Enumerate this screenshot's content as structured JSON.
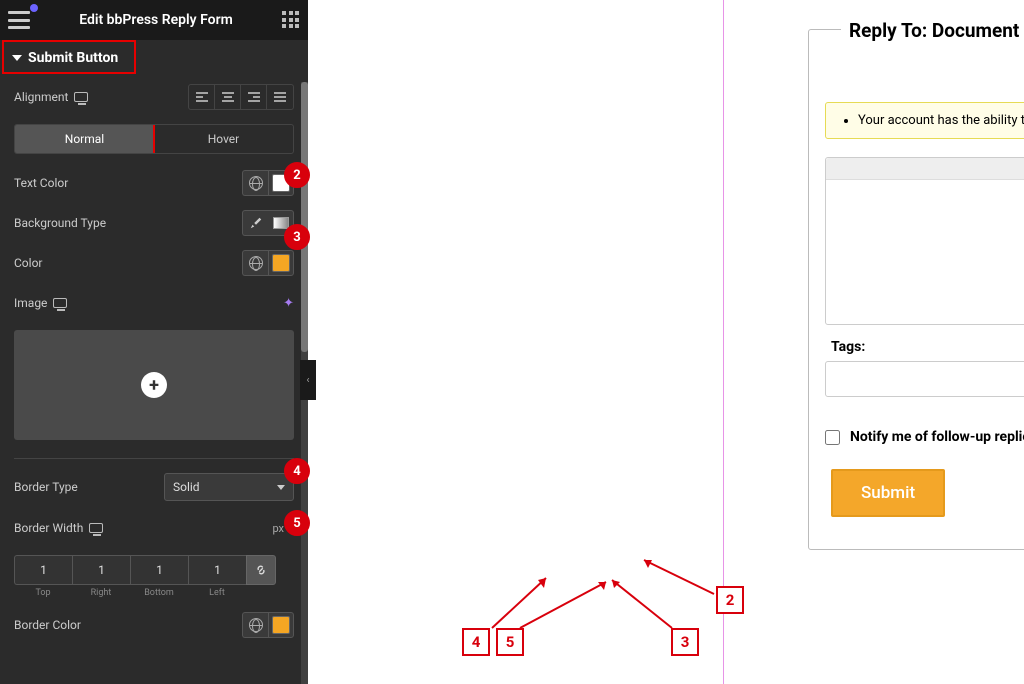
{
  "header": {
    "title": "Edit bbPress Reply Form"
  },
  "accordion": {
    "title": "Submit Button"
  },
  "controls": {
    "alignment_label": "Alignment",
    "tabs": {
      "normal": "Normal",
      "hover": "Hover"
    },
    "text_color_label": "Text Color",
    "bg_type_label": "Background Type",
    "color_label": "Color",
    "image_label": "Image",
    "border_type_label": "Border Type",
    "border_type_value": "Solid",
    "border_width_label": "Border Width",
    "border_width_unit": "px",
    "width_values": {
      "top": "1",
      "right": "1",
      "bottom": "1",
      "left": "1"
    },
    "width_labels": {
      "top": "Top",
      "right": "Right",
      "bottom": "Bottom",
      "left": "Left"
    },
    "border_color_label": "Border Color"
  },
  "preview": {
    "legend": "Reply To: Document Writing",
    "notice": "Your account has the ability to post unrestricted HTML content.",
    "tags_label": "Tags:",
    "notify_label": "Notify me of follow-up replies via email",
    "submit_label": "Submit"
  },
  "annotations": {
    "b2": "2",
    "b3": "3",
    "b4": "4",
    "b5": "5",
    "c2": "2",
    "c3": "3",
    "c4": "4",
    "c5": "5"
  },
  "colors": {
    "swatch_white": "#ffffff",
    "swatch_orange": "#f5a623",
    "submit_bg": "#f4a72a"
  }
}
